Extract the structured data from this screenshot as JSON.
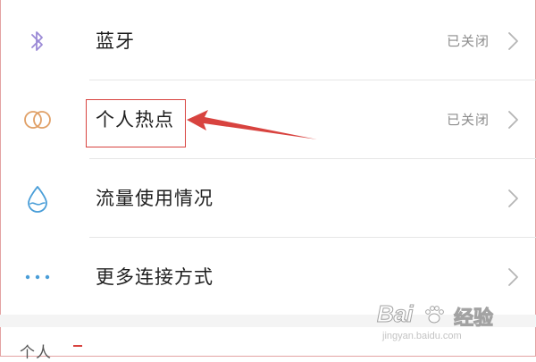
{
  "settings": {
    "items": [
      {
        "label": "蓝牙",
        "status": "已关闭",
        "icon": "bluetooth-icon"
      },
      {
        "label": "个人热点",
        "status": "已关闭",
        "icon": "hotspot-icon"
      },
      {
        "label": "流量使用情况",
        "status": "",
        "icon": "data-usage-icon"
      },
      {
        "label": "更多连接方式",
        "status": "",
        "icon": "more-icon"
      }
    ],
    "next_section_label": "个人"
  },
  "annotation": {
    "highlight_color": "#d8433f"
  },
  "watermark": {
    "brand": "Bai",
    "cn": "经验",
    "url": "jingyan.baidu.com"
  },
  "colors": {
    "bluetooth": "#9b8ad6",
    "hotspot": "#e0a067",
    "data_usage": "#4a9ed8",
    "more": "#4a9ed8"
  }
}
